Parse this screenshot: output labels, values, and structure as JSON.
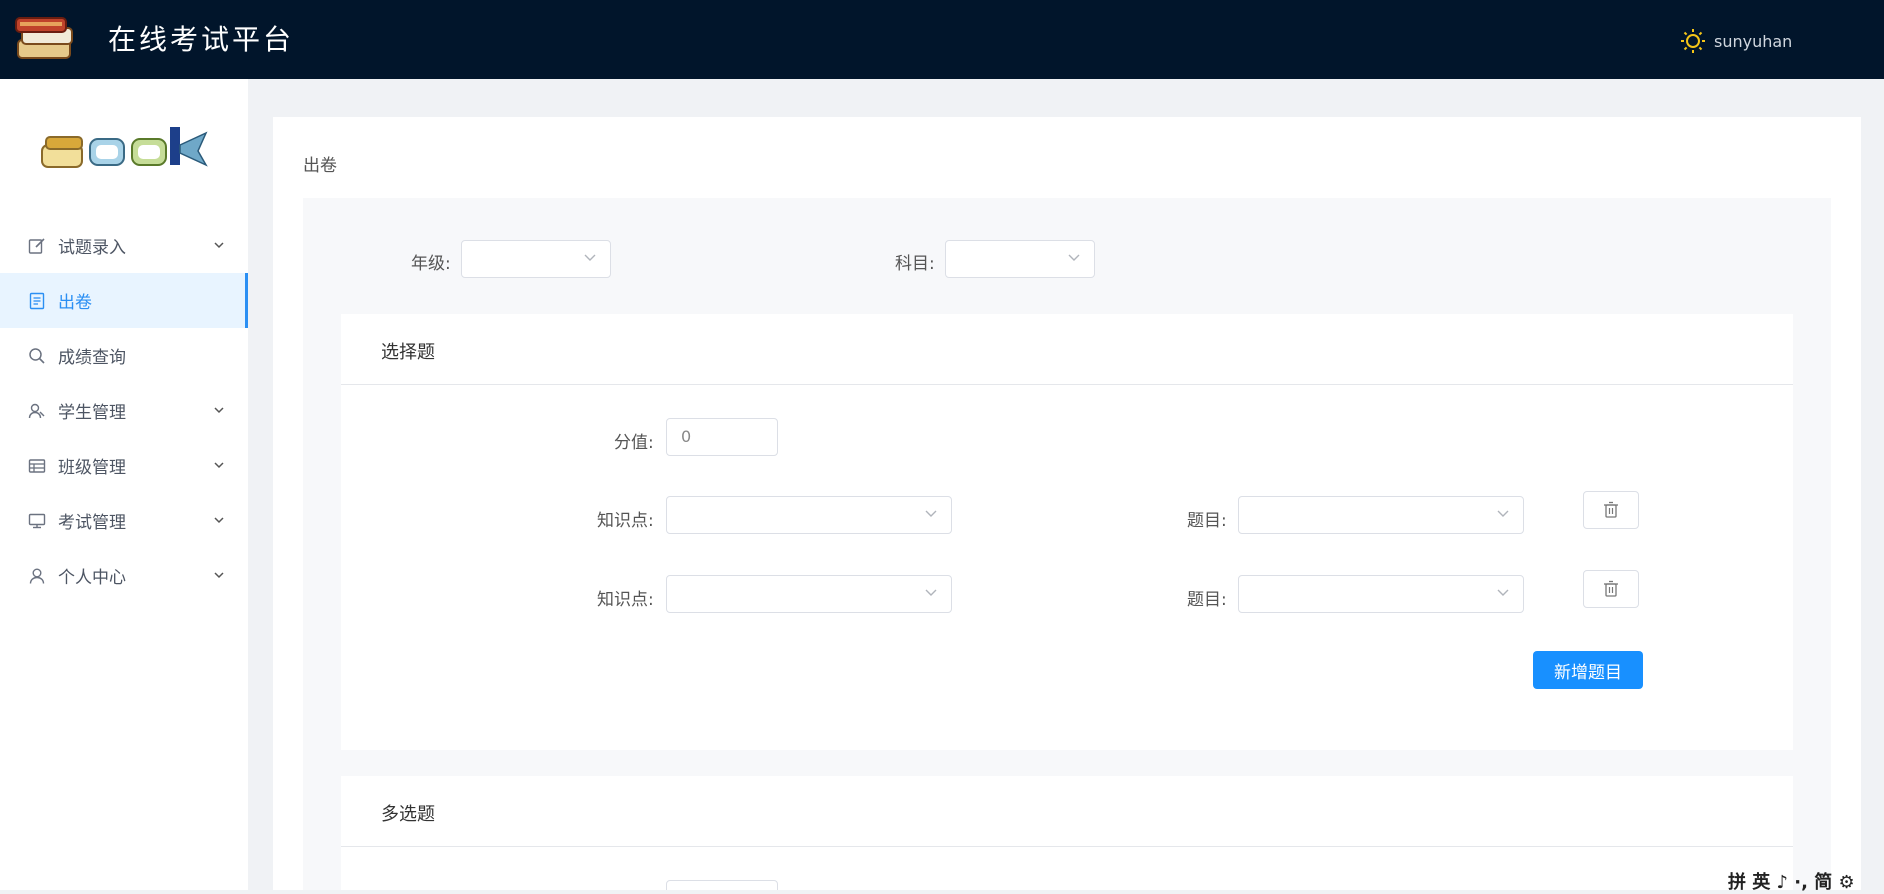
{
  "header": {
    "title": "在线考试平台",
    "username": "sunyuhan"
  },
  "sidebar": {
    "items": [
      {
        "label": "试题录入",
        "icon": "edit-icon",
        "has_children": true
      },
      {
        "label": "出卷",
        "icon": "document-icon",
        "has_children": false,
        "active": true
      },
      {
        "label": "成绩查询",
        "icon": "search-icon",
        "has_children": false
      },
      {
        "label": "学生管理",
        "icon": "user-group-icon",
        "has_children": true
      },
      {
        "label": "班级管理",
        "icon": "table-icon",
        "has_children": true
      },
      {
        "label": "考试管理",
        "icon": "monitor-icon",
        "has_children": true
      },
      {
        "label": "个人中心",
        "icon": "user-icon",
        "has_children": true
      }
    ]
  },
  "page": {
    "breadcrumb": "出卷",
    "filters": {
      "grade_label": "年级:",
      "subject_label": "科目:"
    },
    "single_choice": {
      "title": "选择题",
      "score_label": "分值:",
      "score_value": "0",
      "rows": [
        {
          "knowledge_label": "知识点:",
          "question_label": "题目:"
        },
        {
          "knowledge_label": "知识点:",
          "question_label": "题目:"
        }
      ],
      "add_button": "新增题目"
    },
    "multiple_choice": {
      "title": "多选题"
    }
  },
  "ime_toolbar": "拼 英 ♪ ·, 简 ⚙",
  "colors": {
    "topbar": "#01152b",
    "accent": "#1890ff",
    "active_bg": "#e8f4ff"
  }
}
